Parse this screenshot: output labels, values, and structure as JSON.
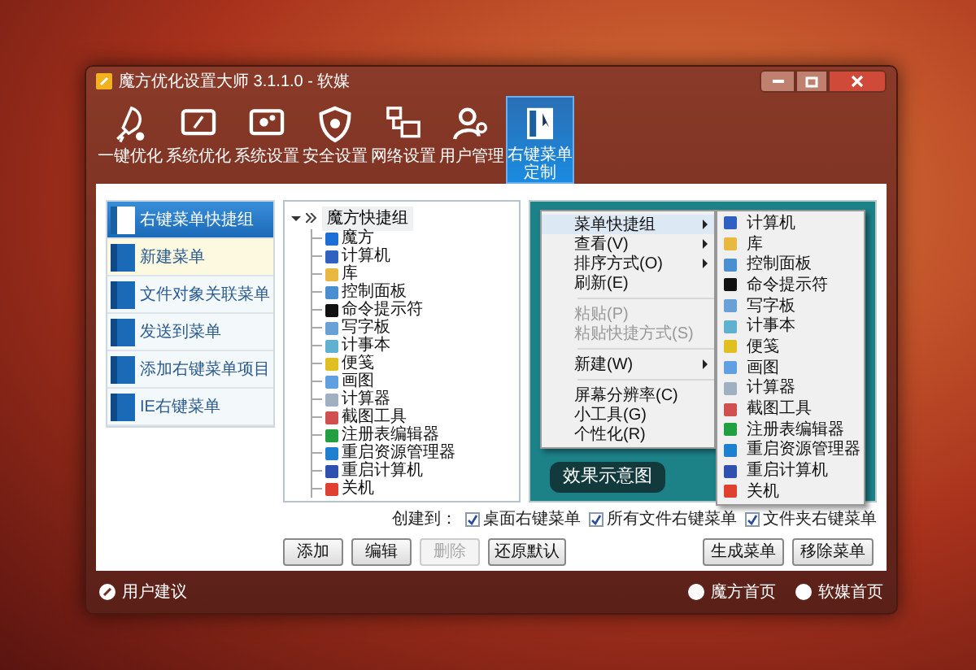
{
  "window": {
    "title": "魔方优化设置大师 3.1.1.0 - 软媒"
  },
  "toolbar": [
    {
      "label": "一键优化",
      "selected": false
    },
    {
      "label": "系统优化",
      "selected": false
    },
    {
      "label": "系统设置",
      "selected": false
    },
    {
      "label": "安全设置",
      "selected": false
    },
    {
      "label": "网络设置",
      "selected": false
    },
    {
      "label": "用户管理",
      "selected": false
    },
    {
      "label": "右键菜单定制",
      "selected": true
    }
  ],
  "sidebar": {
    "items": [
      {
        "label": "右键菜单快捷组",
        "selected": true
      },
      {
        "label": "新建菜单",
        "selected": false
      },
      {
        "label": "文件对象关联菜单",
        "selected": false
      },
      {
        "label": "发送到菜单",
        "selected": false
      },
      {
        "label": "添加右键菜单项目",
        "selected": false
      },
      {
        "label": "IE右键菜单",
        "selected": false
      }
    ]
  },
  "tree": {
    "label": "魔方快捷组",
    "expanded": true,
    "children": [
      {
        "label": "魔方"
      },
      {
        "label": "计算机"
      },
      {
        "label": "库"
      },
      {
        "label": "控制面板"
      },
      {
        "label": "命令提示符"
      },
      {
        "label": "写字板"
      },
      {
        "label": "计事本"
      },
      {
        "label": "便笺"
      },
      {
        "label": "画图"
      },
      {
        "label": "计算器"
      },
      {
        "label": "截图工具"
      },
      {
        "label": "注册表编辑器"
      },
      {
        "label": "重启资源管理器"
      },
      {
        "label": "重启计算机"
      },
      {
        "label": "关机"
      }
    ]
  },
  "tree_buttons": [
    {
      "label": "添加",
      "disabled": false
    },
    {
      "label": "编辑",
      "disabled": false
    },
    {
      "label": "删除",
      "disabled": true
    },
    {
      "label": "还原默认",
      "disabled": false
    }
  ],
  "preview": {
    "menu": [
      {
        "kind": "item",
        "label": "菜单快捷组",
        "submenu": true,
        "disabled": false,
        "selected": true
      },
      {
        "kind": "item",
        "label": "查看(V)",
        "submenu": true,
        "disabled": false,
        "selected": false
      },
      {
        "kind": "item",
        "label": "排序方式(O)",
        "submenu": true,
        "disabled": false,
        "selected": false
      },
      {
        "kind": "item",
        "label": "刷新(E)",
        "submenu": false,
        "disabled": false,
        "selected": false
      },
      {
        "kind": "separator"
      },
      {
        "kind": "item",
        "label": "粘贴(P)",
        "submenu": false,
        "disabled": true,
        "selected": false
      },
      {
        "kind": "item",
        "label": "粘贴快捷方式(S)",
        "submenu": false,
        "disabled": true,
        "selected": false
      },
      {
        "kind": "separator"
      },
      {
        "kind": "item",
        "label": "新建(W)",
        "submenu": true,
        "disabled": false,
        "selected": false
      },
      {
        "kind": "separator"
      },
      {
        "kind": "item",
        "label": "屏幕分辨率(C)",
        "submenu": false,
        "disabled": false,
        "selected": false
      },
      {
        "kind": "item",
        "label": "小工具(G)",
        "submenu": false,
        "disabled": false,
        "selected": false
      },
      {
        "kind": "item",
        "label": "个性化(R)",
        "submenu": false,
        "disabled": false,
        "selected": false
      }
    ],
    "submenu": [
      {
        "label": "计算机"
      },
      {
        "label": "库"
      },
      {
        "label": "控制面板"
      },
      {
        "label": "命令提示符"
      },
      {
        "label": "写字板"
      },
      {
        "label": "计事本"
      },
      {
        "label": "便笺"
      },
      {
        "label": "画图"
      },
      {
        "label": "计算器"
      },
      {
        "label": "截图工具"
      },
      {
        "label": "注册表编辑器"
      },
      {
        "label": "重启资源管理器"
      },
      {
        "label": "重启计算机"
      },
      {
        "label": "关机"
      }
    ],
    "caption": "效果示意图"
  },
  "create_in": {
    "label": "创建到：",
    "options": [
      {
        "label": "桌面右键菜单",
        "checked": true
      },
      {
        "label": "所有文件右键菜单",
        "checked": true
      },
      {
        "label": "文件夹右键菜单",
        "checked": true
      }
    ]
  },
  "action_buttons": [
    {
      "label": "生成菜单"
    },
    {
      "label": "移除菜单"
    }
  ],
  "status_bar": {
    "left": "用户建议",
    "right": [
      "魔方首页",
      "软媒首页"
    ]
  }
}
